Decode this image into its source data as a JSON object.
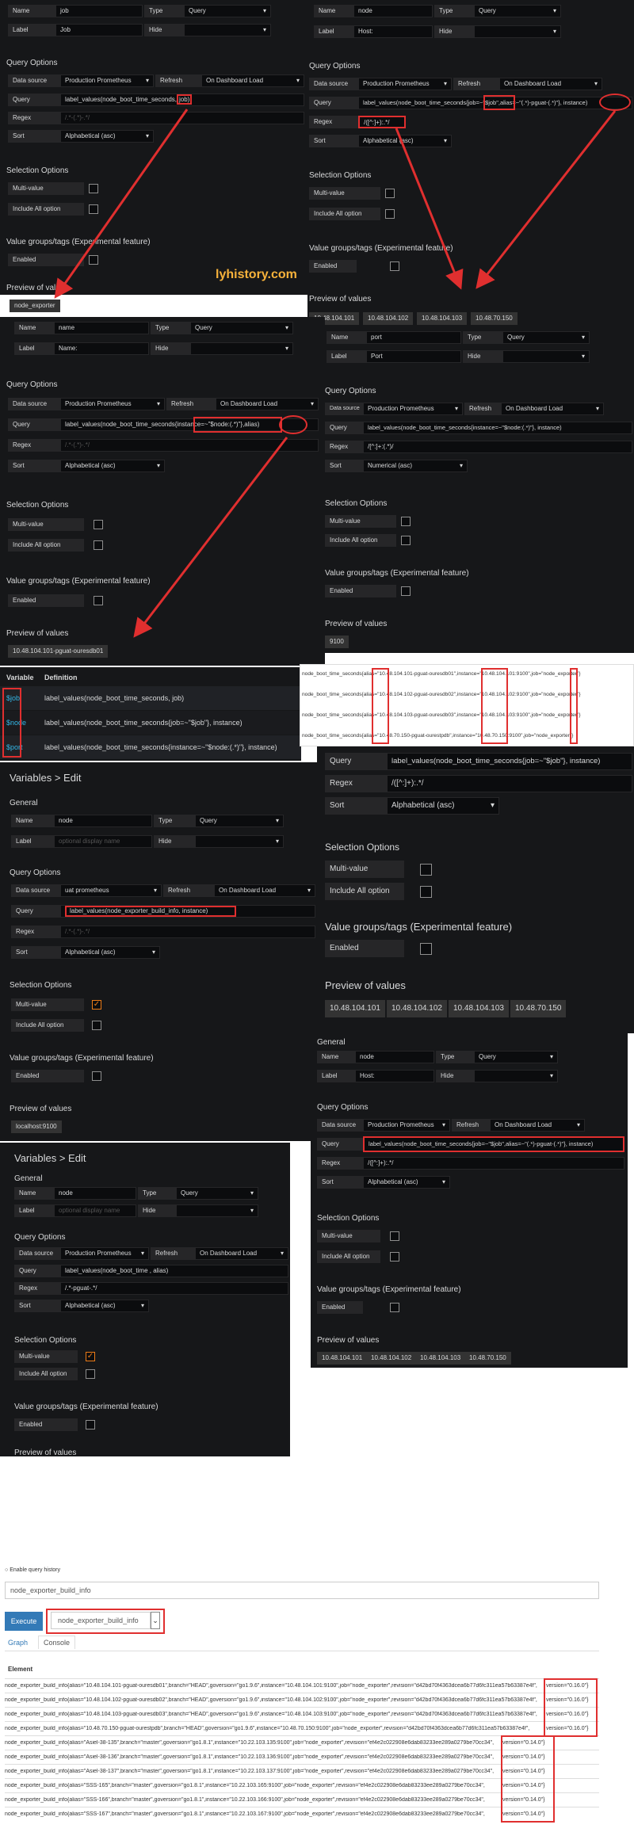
{
  "watermark": "lyhistory.com",
  "panel1": {
    "name_label": "Name",
    "name_value": "job",
    "type_label": "Type",
    "type_value": "Query",
    "label_label": "Label",
    "label_value": "Job",
    "hide_label": "Hide",
    "hide_value": "",
    "section_query": "Query Options",
    "ds_label": "Data source",
    "ds_value": "Production Prometheus",
    "refresh_label": "Refresh",
    "refresh_value": "On Dashboard Load",
    "query_label": "Query",
    "query_value": "label_values(node_boot_time_seconds,",
    "query_value_hl": "job)",
    "regex_label": "Regex",
    "regex_value": "/.*-(.*)-.*/",
    "sort_label": "Sort",
    "sort_value": "Alphabetical (asc)",
    "section_sel": "Selection Options",
    "multi_label": "Multi-value",
    "all_label": "Include All option",
    "section_vg": "Value groups/tags (Experimental feature)",
    "enabled_label": "Enabled",
    "section_prev": "Preview of values",
    "preview": [
      "node_exporter"
    ]
  },
  "panel2": {
    "name_label": "Name",
    "name_value": "node",
    "type_label": "Type",
    "type_value": "Query",
    "label_label": "Label",
    "label_value": "Host:",
    "hide_label": "Hide",
    "hide_value": "",
    "section_query": "Query Options",
    "ds_label": "Data source",
    "ds_value": "Production Prometheus",
    "refresh_label": "Refresh",
    "refresh_value": "On Dashboard Load",
    "query_label": "Query",
    "query_value": "label_values(node_boot_time_seconds{job=~\"$job\",alias=~\"(.*)-pguat-(.*)\"}, instance)",
    "regex_label": "Regex",
    "regex_value": "/([^:]+):.*/",
    "sort_label": "Sort",
    "sort_value": "Alphabetical (asc)",
    "section_sel": "Selection Options",
    "multi_label": "Multi-value",
    "all_label": "Include All option",
    "section_vg": "Value groups/tags (Experimental feature)",
    "enabled_label": "Enabled",
    "section_prev": "Preview of values",
    "preview": [
      "10.48.104.101",
      "10.48.104.102",
      "10.48.104.103",
      "10.48.70.150"
    ]
  },
  "panel3": {
    "name_label": "Name",
    "name_value": "name",
    "type_label": "Type",
    "type_value": "Query",
    "label_label": "Label",
    "label_value": "Name:",
    "hide_label": "Hide",
    "hide_value": "",
    "section_query": "Query Options",
    "ds_label": "Data source",
    "ds_value": "Production Prometheus",
    "refresh_label": "Refresh",
    "refresh_value": "On Dashboard Load",
    "query_label": "Query",
    "query_value": "label_values(node_boot_time_seconds{instance=~\"$node:(.*)\"},alias)",
    "regex_label": "Regex",
    "regex_value": "/.*-(.*)-.*/",
    "sort_label": "Sort",
    "sort_value": "Alphabetical (asc)",
    "section_sel": "Selection Options",
    "multi_label": "Multi-value",
    "all_label": "Include All option",
    "section_vg": "Value groups/tags (Experimental feature)",
    "enabled_label": "Enabled",
    "section_prev": "Preview of values",
    "preview": [
      "10.48.104.101-pguat-ouresdb01"
    ]
  },
  "panel4": {
    "name_label": "Name",
    "name_value": "port",
    "type_label": "Type",
    "type_value": "Query",
    "label_label": "Label",
    "label_value": "Port",
    "hide_label": "Hide",
    "hide_value": "",
    "section_query": "Query Options",
    "ds_label": "Data source",
    "ds_value": "Production Prometheus",
    "refresh_label": "Refresh",
    "refresh_value": "On Dashboard Load",
    "query_label": "Query",
    "query_value": "label_values(node_boot_time_seconds{instance=~\"$node:(.*)\"}, instance)",
    "regex_label": "Regex",
    "regex_value": "/[^:]+:(.*)/",
    "sort_label": "Sort",
    "sort_value": "Numerical (asc)",
    "section_sel": "Selection Options",
    "multi_label": "Multi-value",
    "all_label": "Include All option",
    "section_vg": "Value groups/tags (Experimental feature)",
    "enabled_label": "Enabled",
    "section_prev": "Preview of values",
    "preview": [
      "9100"
    ]
  },
  "vars_table": {
    "col_variable": "Variable",
    "col_definition": "Definition",
    "rows": [
      {
        "name": "$job",
        "def": "label_values(node_boot_time_seconds, job)"
      },
      {
        "name": "$node",
        "def": "label_values(node_boot_time_seconds{job=~\"$job\"}, instance)"
      },
      {
        "name": "$port",
        "def": "label_values(node_boot_time_seconds{instance=~\"$node:(.*)\"}, instance)"
      }
    ]
  },
  "series_box": {
    "rows": [
      {
        "a": "node_boot_time_seconds{",
        "b": "alias=",
        "c": "\"10.48.104.101-pguat-ouresdb01\",",
        "d": "instance=",
        "e": "\"10.48.104.101:9100\",",
        "f": "job=\"node_exporter\"}"
      },
      {
        "a": "node_boot_time_seconds{",
        "b": "alias=",
        "c": "\"10.48.104.102-pguat-ouresdb02\",",
        "d": "instance=",
        "e": "\"10.48.104.102:9100\",",
        "f": "job=\"node_exporter\"}"
      },
      {
        "a": "node_boot_time_seconds{",
        "b": "alias=",
        "c": "\"10.48.104.103-pguat-ouresdb03\",",
        "d": "instance=",
        "e": "\"10.48.104.103:9100\",",
        "f": "job=\"node_exporter\"}"
      },
      {
        "a": "node_boot_time_seconds{",
        "b": "alias=",
        "c": "\"10.48.70.150-pguat-ourestpdb\",",
        "d": "instance=",
        "e": "\"10.48.70.150:9100\",",
        "f": "job=\"node_exporter\"}"
      }
    ]
  },
  "panel5": {
    "title": "Variables > Edit",
    "section_general": "General",
    "name_label": "Name",
    "name_value": "node",
    "type_label": "Type",
    "type_value": "Query",
    "label_label": "Label",
    "label_placeholder": "optional display name",
    "hide_label": "Hide",
    "hide_value": "",
    "section_query": "Query Options",
    "ds_label": "Data source",
    "ds_value": "uat prometheus",
    "refresh_label": "Refresh",
    "refresh_value": "On Dashboard Load",
    "query_label": "Query",
    "query_value": "label_values(node_exporter_build_info, instance)",
    "regex_label": "Regex",
    "regex_value": "/.*-(.*)-.*/",
    "sort_label": "Sort",
    "sort_value": "Alphabetical (asc)",
    "section_sel": "Selection Options",
    "multi_label": "Multi-value",
    "all_label": "Include All option",
    "section_vg": "Value groups/tags (Experimental feature)",
    "enabled_label": "Enabled",
    "section_prev": "Preview of values",
    "preview": [
      "localhost:9100"
    ]
  },
  "panel6": {
    "query_label": "Query",
    "query_value": "label_values(node_boot_time_seconds{job=~\"$job\"}, instance)",
    "regex_label": "Regex",
    "regex_value": "/([^:]+):.*/",
    "sort_label": "Sort",
    "sort_value": "Alphabetical (asc)",
    "section_sel": "Selection Options",
    "multi_label": "Multi-value",
    "all_label": "Include All option",
    "section_vg": "Value groups/tags (Experimental feature)",
    "enabled_label": "Enabled",
    "section_prev": "Preview of values",
    "preview": [
      "10.48.104.101",
      "10.48.104.102",
      "10.48.104.103",
      "10.48.70.150"
    ]
  },
  "panel7": {
    "title": "Variables > Edit",
    "section_general": "General",
    "name_label": "Name",
    "name_value": "node",
    "type_label": "Type",
    "type_value": "Query",
    "label_label": "Label",
    "label_placeholder": "optional display name",
    "hide_label": "Hide",
    "hide_value": "",
    "section_query": "Query Options",
    "ds_label": "Data source",
    "ds_value": "Production Prometheus",
    "refresh_label": "Refresh",
    "refresh_value": "On Dashboard Load",
    "query_label": "Query",
    "query_value": "label_values(node_boot_time , alias)",
    "regex_label": "Regex",
    "regex_value": "/.*-pguat-.*/",
    "sort_label": "Sort",
    "sort_value": "Alphabetical (asc)",
    "section_sel": "Selection Options",
    "multi_label": "Multi-value",
    "all_label": "Include All option",
    "section_vg": "Value groups/tags (Experimental feature)",
    "enabled_label": "Enabled",
    "section_prev": "Preview of values"
  },
  "panel8": {
    "section_general": "General",
    "name_label": "Name",
    "name_value": "node",
    "type_label": "Type",
    "type_value": "Query",
    "label_label": "Label",
    "label_value": "Host:",
    "hide_label": "Hide",
    "hide_value": "",
    "section_query": "Query Options",
    "ds_label": "Data source",
    "ds_value": "Production Prometheus",
    "refresh_label": "Refresh",
    "refresh_value": "On Dashboard Load",
    "query_label": "Query",
    "query_value": "label_values(node_boot_time_seconds{job=~\"$job\",alias=~\"(.*)-pguat-(.*)\"}, instance)",
    "regex_label": "Regex",
    "regex_value": "/([^:]+):.*/",
    "sort_label": "Sort",
    "sort_value": "Alphabetical (asc)",
    "section_sel": "Selection Options",
    "multi_label": "Multi-value",
    "all_label": "Include All option",
    "section_vg": "Value groups/tags (Experimental feature)",
    "enabled_label": "Enabled",
    "section_prev": "Preview of values",
    "preview": [
      "10.48.104.101",
      "10.48.104.102",
      "10.48.104.103",
      "10.48.70.150"
    ]
  },
  "console": {
    "enable_history": "Enable query history",
    "query_input": "node_exporter_build_info",
    "execute": "Execute",
    "metric_select": "node_exporter_build_info",
    "tab_graph": "Graph",
    "tab_console": "Console",
    "col_element": "Element",
    "rows": [
      {
        "left": "node_exporter_build_info{alias=\"10.48.104.101-pguat-ouresdb01\",branch=\"HEAD\",goversion=\"go1.9.6\",instance=\"10.48.104.101:9100\",job=\"node_exporter\",revision=\"d42bd70f4363dcea6b77d6fc311ea57b63387e4f\",",
        "ver": "version=\"0.16.0\"}"
      },
      {
        "left": "node_exporter_build_info{alias=\"10.48.104.102-pguat-ouresdb02\",branch=\"HEAD\",goversion=\"go1.9.6\",instance=\"10.48.104.102:9100\",job=\"node_exporter\",revision=\"d42bd70f4363dcea6b77d6fc311ea57b63387e4f\",",
        "ver": "version=\"0.16.0\"}"
      },
      {
        "left": "node_exporter_build_info{alias=\"10.48.104.103-pguat-ouresdb03\",branch=\"HEAD\",goversion=\"go1.9.6\",instance=\"10.48.104.103:9100\",job=\"node_exporter\",revision=\"d42bd70f4363dcea6b77d6fc311ea57b63387e4f\",",
        "ver": "version=\"0.16.0\"}"
      },
      {
        "left": "node_exporter_build_info{alias=\"10.48.70.150-pguat-ourestpdb\",branch=\"HEAD\",goversion=\"go1.9.6\",instance=\"10.48.70.150:9100\",job=\"node_exporter\",revision=\"d42bd70f4363dcea6b77d6fc311ea57b63387e4f\",",
        "ver": "version=\"0.16.0\"}"
      },
      {
        "left": "node_exporter_build_info{alias=\"Asiel-38-135\",branch=\"master\",goversion=\"go1.8.1\",instance=\"10.22.103.135:9100\",job=\"node_exporter\",revision=\"ef4e2c022908e6dab83233ee289a0279be70cc34\",",
        "ver": "version=\"0.14.0\"}"
      },
      {
        "left": "node_exporter_build_info{alias=\"Asiel-38-136\",branch=\"master\",goversion=\"go1.8.1\",instance=\"10.22.103.136:9100\",job=\"node_exporter\",revision=\"ef4e2c022908e6dab83233ee289a0279be70cc34\",",
        "ver": "version=\"0.14.0\"}"
      },
      {
        "left": "node_exporter_build_info{alias=\"Asiel-38-137\",branch=\"master\",goversion=\"go1.8.1\",instance=\"10.22.103.137:9100\",job=\"node_exporter\",revision=\"ef4e2c022908e6dab83233ee289a0279be70cc34\",",
        "ver": "version=\"0.14.0\"}"
      },
      {
        "left": "node_exporter_build_info{alias=\"SSS-165\",branch=\"master\",goversion=\"go1.8.1\",instance=\"10.22.103.165:9100\",job=\"node_exporter\",revision=\"ef4e2c022908e6dab83233ee289a0279be70cc34\",",
        "ver": "version=\"0.14.0\"}"
      },
      {
        "left": "node_exporter_build_info{alias=\"SSS-166\",branch=\"master\",goversion=\"go1.8.1\",instance=\"10.22.103.166:9100\",job=\"node_exporter\",revision=\"ef4e2c022908e6dab83233ee289a0279be70cc34\",",
        "ver": "version=\"0.14.0\"}"
      },
      {
        "left": "node_exporter_build_info{alias=\"SSS-167\",branch=\"master\",goversion=\"go1.8.1\",instance=\"10.22.103.167:9100\",job=\"node_exporter\",revision=\"ef4e2c022908e6dab83233ee289a0279be70cc34\",",
        "ver": "version=\"0.14.0\"}"
      }
    ]
  },
  "colors": {
    "annotation": "#e02f2f",
    "accent": "#eb7b18",
    "bg": "#161719",
    "var_blue": "#33b5e5"
  }
}
